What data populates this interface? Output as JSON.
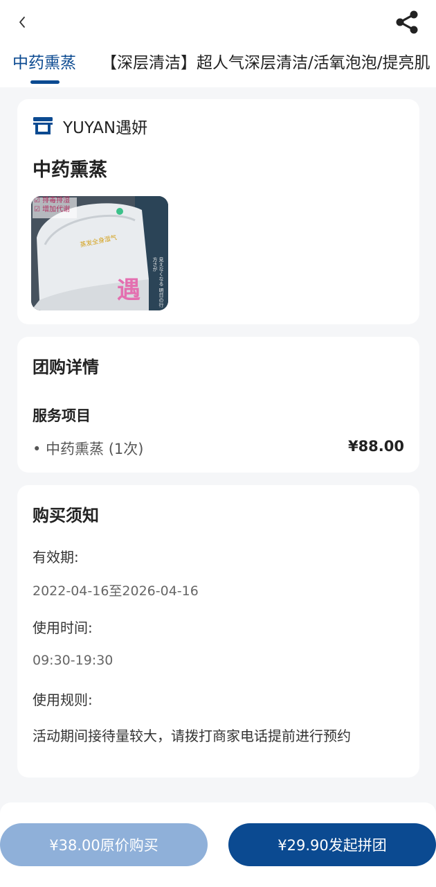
{
  "header": {
    "back_icon": "chevron-left-icon",
    "share_icon": "share-icon"
  },
  "tabs": [
    {
      "label": "中药熏蒸",
      "active": true
    },
    {
      "label": "【深层清洁】超人气深层清洁/活氧泡泡/提亮肌",
      "active": false
    }
  ],
  "shop": {
    "store_icon": "store-icon",
    "name": "YUYAN遇妍",
    "product_title": "中药熏蒸",
    "image_text": {
      "top_line1": "☑ 排毒排湿",
      "top_line2": "☑ 增加代谢",
      "center": "蒸发全身湿气",
      "side": "見えなくなる 明日の行方さが",
      "brand": "遇"
    }
  },
  "group_detail": {
    "heading": "团购详情",
    "section_title": "服务项目",
    "items": [
      {
        "name": "• 中药熏蒸 (1次)",
        "price": "¥88.00"
      }
    ]
  },
  "notice": {
    "heading": "购买须知",
    "validity_label": "有效期:",
    "validity_value": "2022-04-16至2026-04-16",
    "time_label": "使用时间:",
    "time_value": "09:30-19:30",
    "rules_label": "使用规则:",
    "rules_value": "活动期间接待量较大，请拨打商家电话提前进行预约"
  },
  "bottom": {
    "original_buy": "¥38.00原价购买",
    "group_buy": "¥29.90发起拼团"
  },
  "colors": {
    "primary": "#0b4a91",
    "secondary_button": "#8fb0d9",
    "background": "#f5f6f8"
  }
}
